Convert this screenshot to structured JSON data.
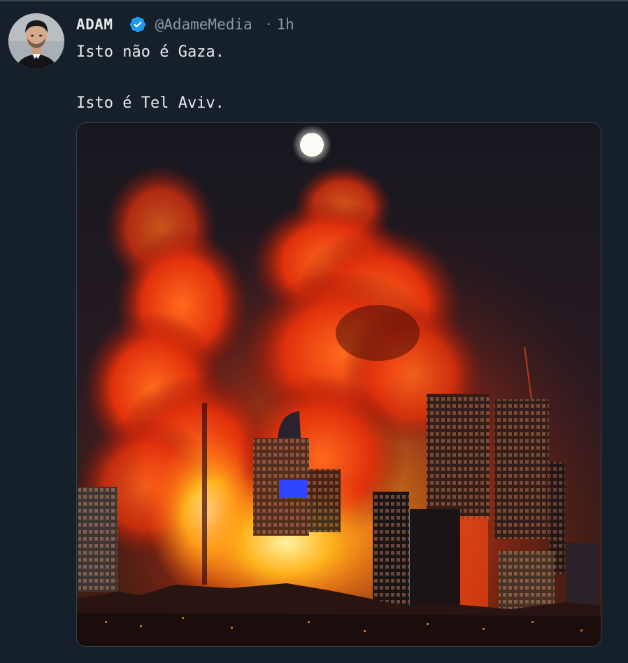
{
  "tweet": {
    "author_name": "ADAM",
    "verified_icon": "verified-badge-icon",
    "handle": "@AdameMedia",
    "separator": "·",
    "time": "1h",
    "text_line1": "Isto não é Gaza.",
    "text_line2": "Isto é Tel Aviv.",
    "media": {
      "icon": "city-fire-photo"
    }
  },
  "colors": {
    "background": "#15202b",
    "text": "#e7e9ea",
    "muted": "#8b98a5",
    "verified": "#1d9bf0"
  }
}
